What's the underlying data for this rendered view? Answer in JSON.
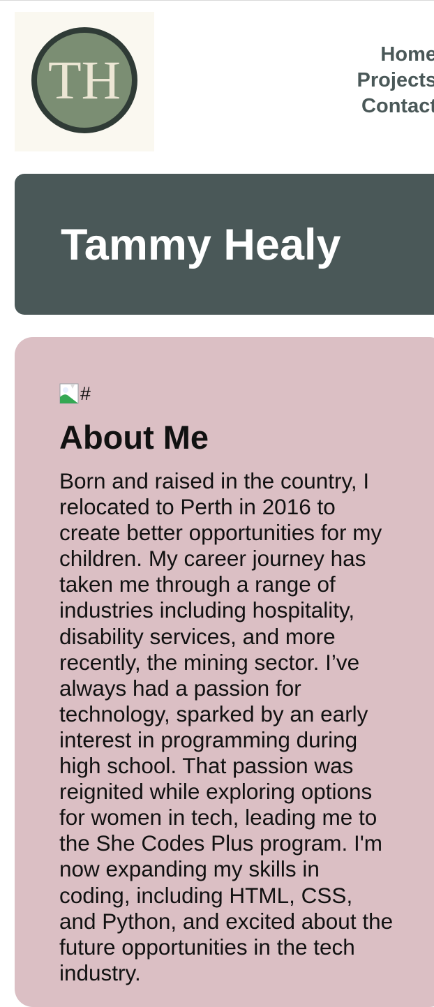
{
  "logo": {
    "initials": "TH"
  },
  "nav": {
    "items": [
      "Home",
      "Projects",
      "Contact"
    ]
  },
  "hero": {
    "name": "Tammy Healy"
  },
  "about": {
    "image_alt": "#",
    "heading": "About Me",
    "body": "Born and raised in the country, I relocated to Perth in 2016 to create better opportunities for my children. My career journey has taken me through a range of industries including hospitality, disability services, and more recently, the mining sector. I’ve always had a passion for technology, sparked by an early interest in programming during high school. That passion was reignited while exploring options for women in tech, leading me to the She Codes Plus program. I'm now expanding my skills in coding, including HTML, CSS, and Python, and excited about the future opportunities in the tech industry."
  },
  "colors": {
    "hero_bg": "#4a5858",
    "about_bg": "#dbbfc4",
    "logo_bg": "#faf8f0",
    "logo_ring": "#2f3b36",
    "logo_fill": "#7b8e73",
    "logo_text": "#ece6d4"
  }
}
